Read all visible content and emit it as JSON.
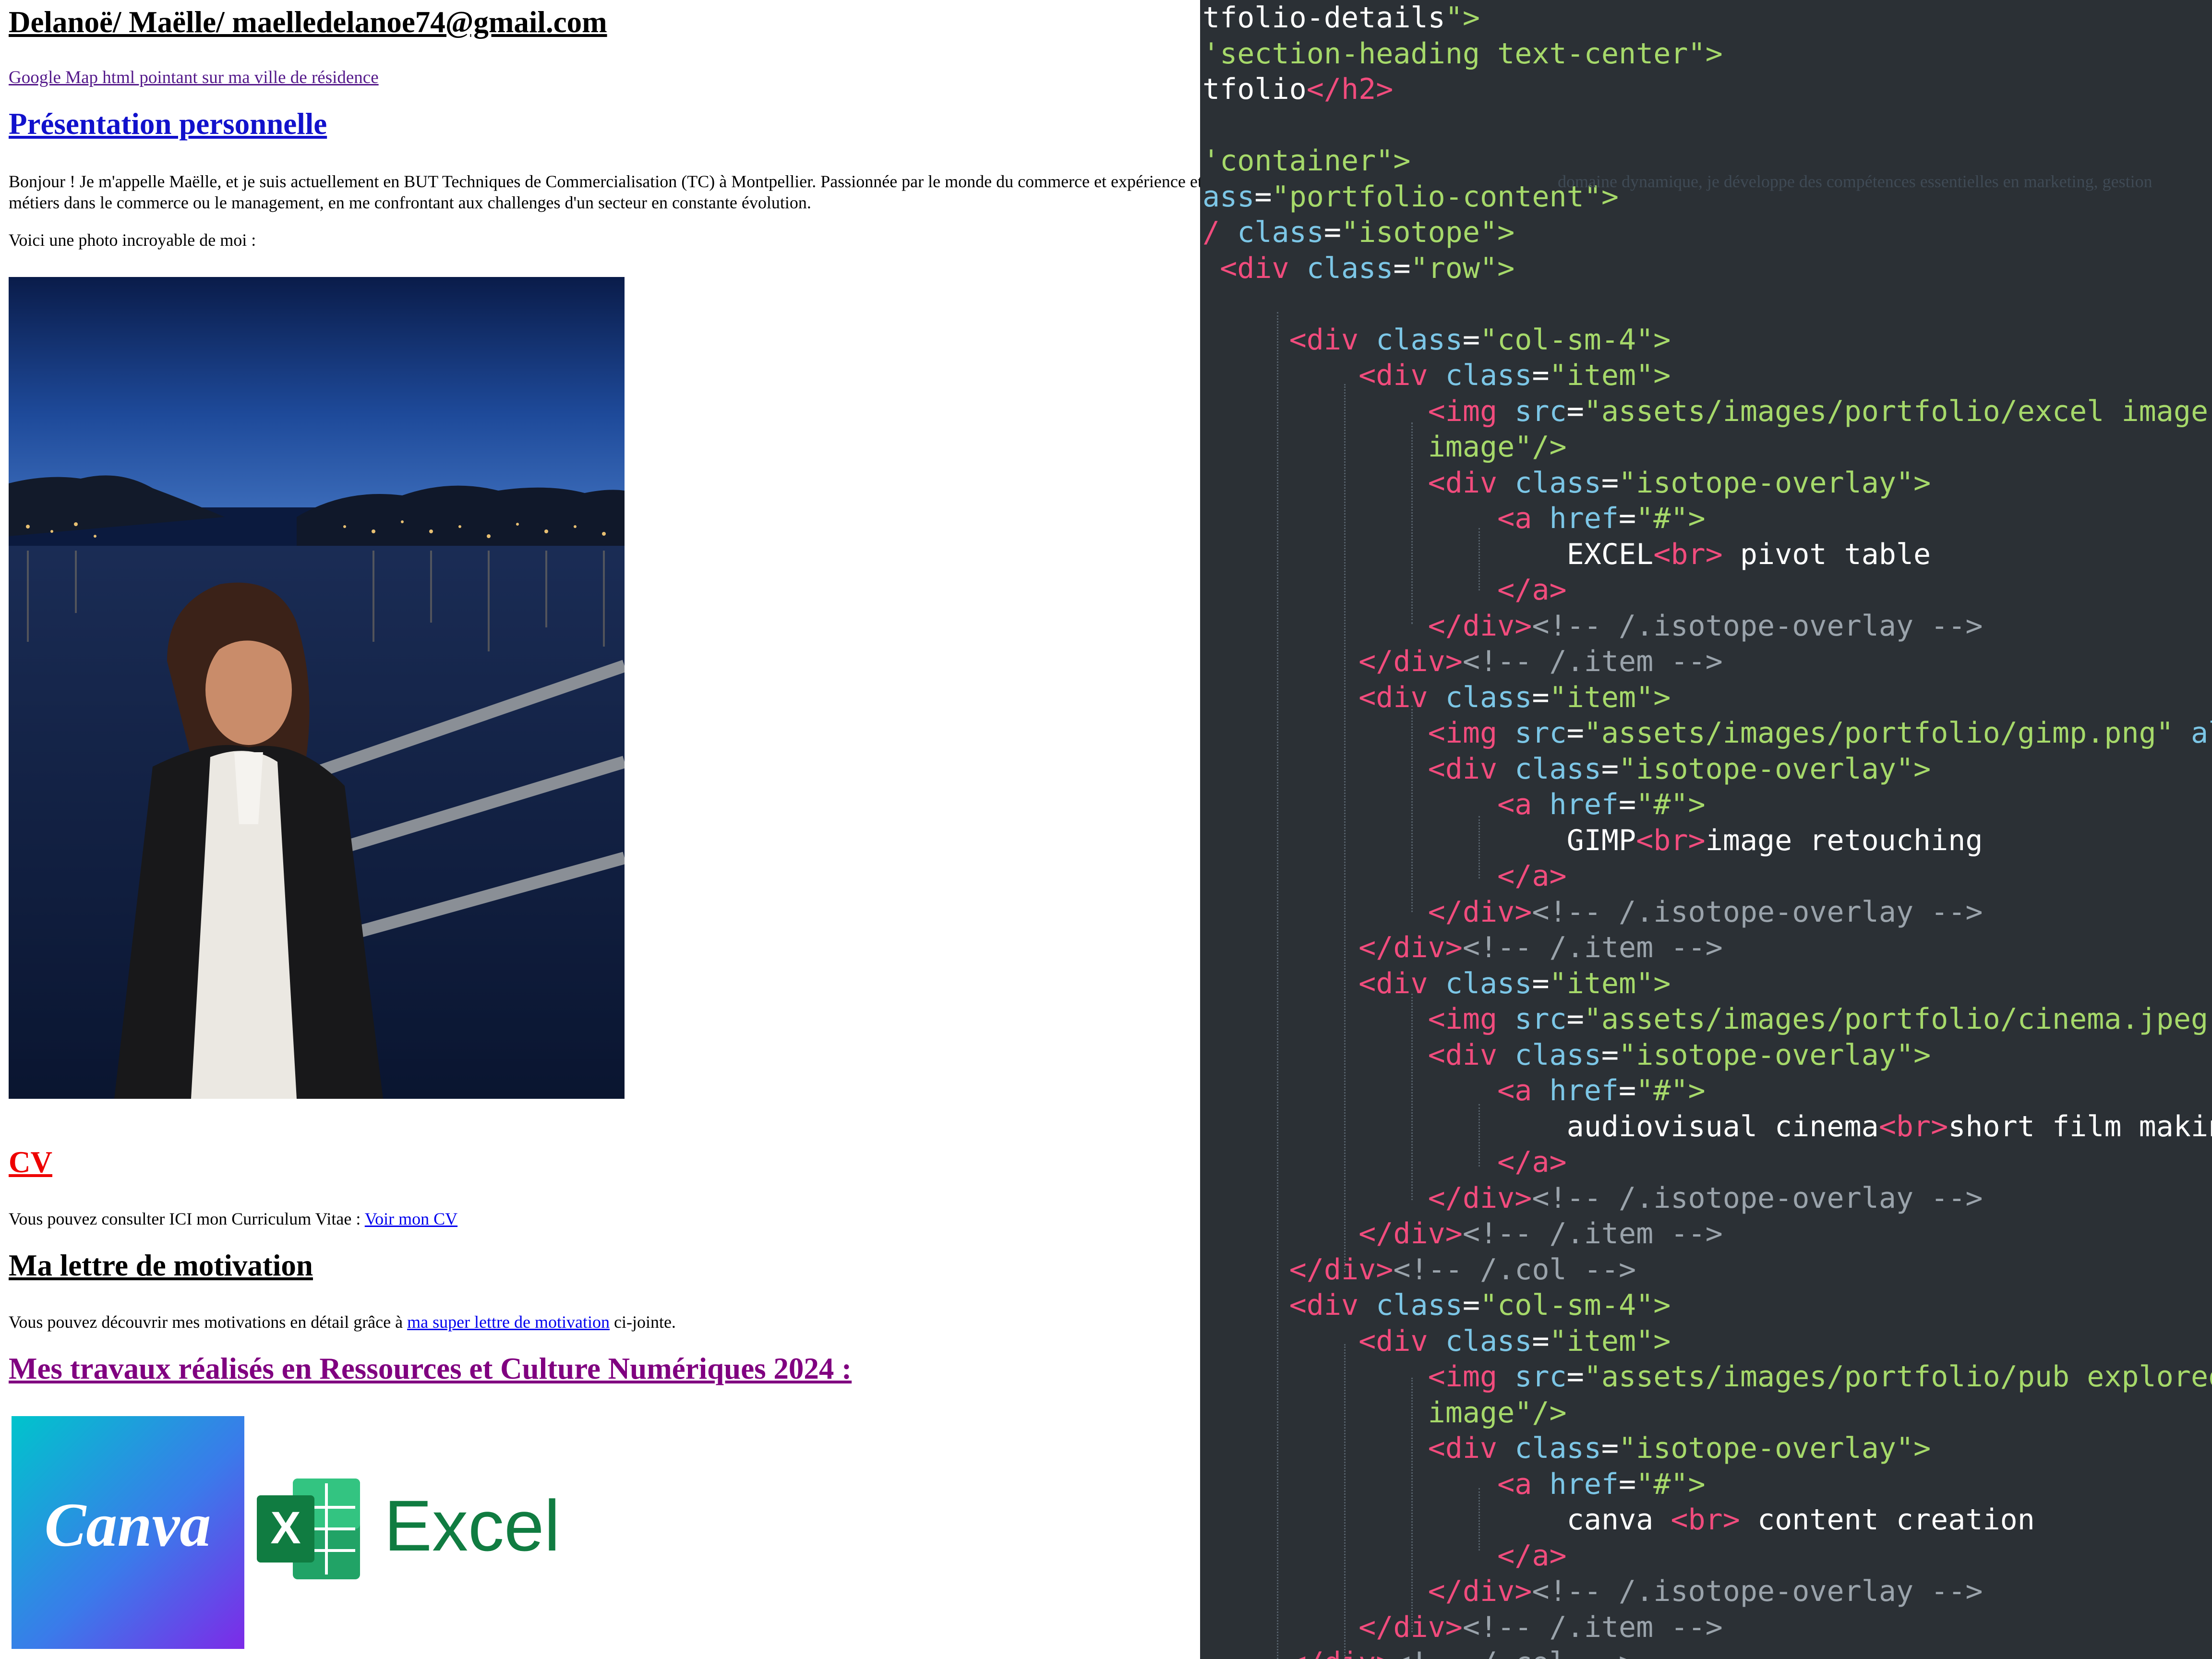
{
  "page": {
    "title": "Delanoë/ Maëlle/ maelledelanoe74@gmail.com",
    "map_link": "Google Map html pointant sur ma ville de résidence",
    "presentation_heading": "Présentation personnelle",
    "presentation_text": "Bonjour ! Je m'appelle Maëlle, et je suis actuellement en BUT Techniques de Commercialisation (TC) à Montpellier. Passionnée par le monde du commerce et expérience et de me préparer à des métiers dans le commerce ou le management, en me confrontant aux challenges d'un secteur en constante évolution.",
    "photo_intro": "Voici une photo incroyable de moi :",
    "cv_heading": "CV",
    "cv_text": "Vous pouvez consulter ICI mon Curriculum Vitae : ",
    "cv_link": "Voir mon CV",
    "letter_heading": "Ma lettre de motivation",
    "letter_text_before": "Vous pouvez découvrir mes motivations en détail grâce à ",
    "letter_link": "ma super lettre de motivation",
    "letter_text_after": " ci-jointe.",
    "works_heading": "Mes travaux réalisés en Ressources et Culture Numériques 2024 :",
    "canva_logo_text": "Canva",
    "excel_logo_text": "Excel",
    "ghost_text": "domaine dynamique, je développe des compétences essentielles en marketing, gestion"
  },
  "editor": {
    "lines": [
      [
        [
          "x",
          "tfolio-details"
        ],
        [
          "s",
          "\">"
        ]
      ],
      [
        [
          "s",
          "'section-heading text-center\">"
        ]
      ],
      [
        [
          "x",
          "tfolio"
        ],
        [
          "t",
          "</h2"
        ],
        [
          "t",
          ">"
        ]
      ],
      [
        [
          "x",
          ""
        ]
      ],
      [
        [
          "s",
          "'container\">"
        ]
      ],
      [
        [
          "a",
          "ass"
        ],
        [
          "x",
          "="
        ],
        [
          "s",
          "\"portfolio-content\">"
        ]
      ],
      [
        [
          "t",
          "/ "
        ],
        [
          "a",
          "class"
        ],
        [
          "x",
          "="
        ],
        [
          "s",
          "\"isotope\">"
        ]
      ],
      [
        [
          "x",
          " "
        ],
        [
          "t",
          "<div "
        ],
        [
          "a",
          "class"
        ],
        [
          "x",
          "="
        ],
        [
          "s",
          "\"row\">"
        ]
      ],
      [
        [
          "x",
          ""
        ]
      ],
      [
        [
          "x",
          "     "
        ],
        [
          "t",
          "<div "
        ],
        [
          "a",
          "class"
        ],
        [
          "x",
          "="
        ],
        [
          "s",
          "\"col-sm-4\">"
        ]
      ],
      [
        [
          "x",
          "         "
        ],
        [
          "t",
          "<div "
        ],
        [
          "a",
          "class"
        ],
        [
          "x",
          "="
        ],
        [
          "s",
          "\"item\">"
        ]
      ],
      [
        [
          "x",
          "             "
        ],
        [
          "t",
          "<img "
        ],
        [
          "a",
          "src"
        ],
        [
          "x",
          "="
        ],
        [
          "s",
          "\"assets/images/portfolio/excel image.jp"
        ]
      ],
      [
        [
          "x",
          "             "
        ],
        [
          "s",
          "image\"/>"
        ]
      ],
      [
        [
          "x",
          "             "
        ],
        [
          "t",
          "<div "
        ],
        [
          "a",
          "class"
        ],
        [
          "x",
          "="
        ],
        [
          "s",
          "\"isotope-overlay\">"
        ]
      ],
      [
        [
          "x",
          "                 "
        ],
        [
          "t",
          "<a "
        ],
        [
          "a",
          "href"
        ],
        [
          "x",
          "="
        ],
        [
          "s",
          "\"#\">"
        ]
      ],
      [
        [
          "x",
          "                     EXCEL"
        ],
        [
          "t",
          "<br>"
        ],
        [
          "x",
          " pivot table"
        ]
      ],
      [
        [
          "x",
          "                 "
        ],
        [
          "t",
          "</a>"
        ]
      ],
      [
        [
          "x",
          "             "
        ],
        [
          "t",
          "</div>"
        ],
        [
          "c",
          "<!-- /.isotope-overlay -->"
        ]
      ],
      [
        [
          "x",
          "         "
        ],
        [
          "t",
          "</div>"
        ],
        [
          "c",
          "<!-- /.item -->"
        ]
      ],
      [
        [
          "x",
          "         "
        ],
        [
          "t",
          "<div "
        ],
        [
          "a",
          "class"
        ],
        [
          "x",
          "="
        ],
        [
          "s",
          "\"item\">"
        ]
      ],
      [
        [
          "x",
          "             "
        ],
        [
          "t",
          "<img "
        ],
        [
          "a",
          "src"
        ],
        [
          "x",
          "="
        ],
        [
          "s",
          "\"assets/images/portfolio/gimp.png\" "
        ],
        [
          "a",
          "alt"
        ],
        [
          "x",
          "="
        ]
      ],
      [
        [
          "x",
          "             "
        ],
        [
          "t",
          "<div "
        ],
        [
          "a",
          "class"
        ],
        [
          "x",
          "="
        ],
        [
          "s",
          "\"isotope-overlay\">"
        ]
      ],
      [
        [
          "x",
          "                 "
        ],
        [
          "t",
          "<a "
        ],
        [
          "a",
          "href"
        ],
        [
          "x",
          "="
        ],
        [
          "s",
          "\"#\">"
        ]
      ],
      [
        [
          "x",
          "                     GIMP"
        ],
        [
          "t",
          "<br>"
        ],
        [
          "x",
          "image retouching"
        ]
      ],
      [
        [
          "x",
          "                 "
        ],
        [
          "t",
          "</a>"
        ]
      ],
      [
        [
          "x",
          "             "
        ],
        [
          "t",
          "</div>"
        ],
        [
          "c",
          "<!-- /.isotope-overlay -->"
        ]
      ],
      [
        [
          "x",
          "         "
        ],
        [
          "t",
          "</div>"
        ],
        [
          "c",
          "<!-- /.item -->"
        ]
      ],
      [
        [
          "x",
          "         "
        ],
        [
          "t",
          "<div "
        ],
        [
          "a",
          "class"
        ],
        [
          "x",
          "="
        ],
        [
          "s",
          "\"item\">"
        ]
      ],
      [
        [
          "x",
          "             "
        ],
        [
          "t",
          "<img "
        ],
        [
          "a",
          "src"
        ],
        [
          "x",
          "="
        ],
        [
          "s",
          "\"assets/images/portfolio/cinema.jpeg\" "
        ],
        [
          "a",
          "a"
        ]
      ],
      [
        [
          "x",
          "             "
        ],
        [
          "t",
          "<div "
        ],
        [
          "a",
          "class"
        ],
        [
          "x",
          "="
        ],
        [
          "s",
          "\"isotope-overlay\">"
        ]
      ],
      [
        [
          "x",
          "                 "
        ],
        [
          "t",
          "<a "
        ],
        [
          "a",
          "href"
        ],
        [
          "x",
          "="
        ],
        [
          "s",
          "\"#\">"
        ]
      ],
      [
        [
          "x",
          "                     audiovisual cinema"
        ],
        [
          "t",
          "<br>"
        ],
        [
          "x",
          "short film making"
        ]
      ],
      [
        [
          "x",
          "                 "
        ],
        [
          "t",
          "</a>"
        ]
      ],
      [
        [
          "x",
          "             "
        ],
        [
          "t",
          "</div>"
        ],
        [
          "c",
          "<!-- /.isotope-overlay -->"
        ]
      ],
      [
        [
          "x",
          "         "
        ],
        [
          "t",
          "</div>"
        ],
        [
          "c",
          "<!-- /.item -->"
        ]
      ],
      [
        [
          "x",
          "     "
        ],
        [
          "t",
          "</div>"
        ],
        [
          "c",
          "<!-- /.col -->"
        ]
      ],
      [
        [
          "x",
          "     "
        ],
        [
          "t",
          "<div "
        ],
        [
          "a",
          "class"
        ],
        [
          "x",
          "="
        ],
        [
          "s",
          "\"col-sm-4\">"
        ]
      ],
      [
        [
          "x",
          "         "
        ],
        [
          "t",
          "<div "
        ],
        [
          "a",
          "class"
        ],
        [
          "x",
          "="
        ],
        [
          "s",
          "\"item\">"
        ]
      ],
      [
        [
          "x",
          "             "
        ],
        [
          "t",
          "<img "
        ],
        [
          "a",
          "src"
        ],
        [
          "x",
          "="
        ],
        [
          "s",
          "\"assets/images/portfolio/pub exploreo.p"
        ]
      ],
      [
        [
          "x",
          "             "
        ],
        [
          "s",
          "image\"/>"
        ]
      ],
      [
        [
          "x",
          "             "
        ],
        [
          "t",
          "<div "
        ],
        [
          "a",
          "class"
        ],
        [
          "x",
          "="
        ],
        [
          "s",
          "\"isotope-overlay\">"
        ]
      ],
      [
        [
          "x",
          "                 "
        ],
        [
          "t",
          "<a "
        ],
        [
          "a",
          "href"
        ],
        [
          "x",
          "="
        ],
        [
          "s",
          "\"#\">"
        ]
      ],
      [
        [
          "x",
          "                     canva "
        ],
        [
          "t",
          "<br>"
        ],
        [
          "x",
          " content creation"
        ]
      ],
      [
        [
          "x",
          "                 "
        ],
        [
          "t",
          "</a>"
        ]
      ],
      [
        [
          "x",
          "             "
        ],
        [
          "t",
          "</div>"
        ],
        [
          "c",
          "<!-- /.isotope-overlay -->"
        ]
      ],
      [
        [
          "x",
          "         "
        ],
        [
          "t",
          "</div>"
        ],
        [
          "c",
          "<!-- /.item -->"
        ]
      ],
      [
        [
          "x",
          "     "
        ],
        [
          "t",
          "</div>"
        ],
        [
          "c",
          "<!-- /.col -->"
        ]
      ]
    ]
  }
}
